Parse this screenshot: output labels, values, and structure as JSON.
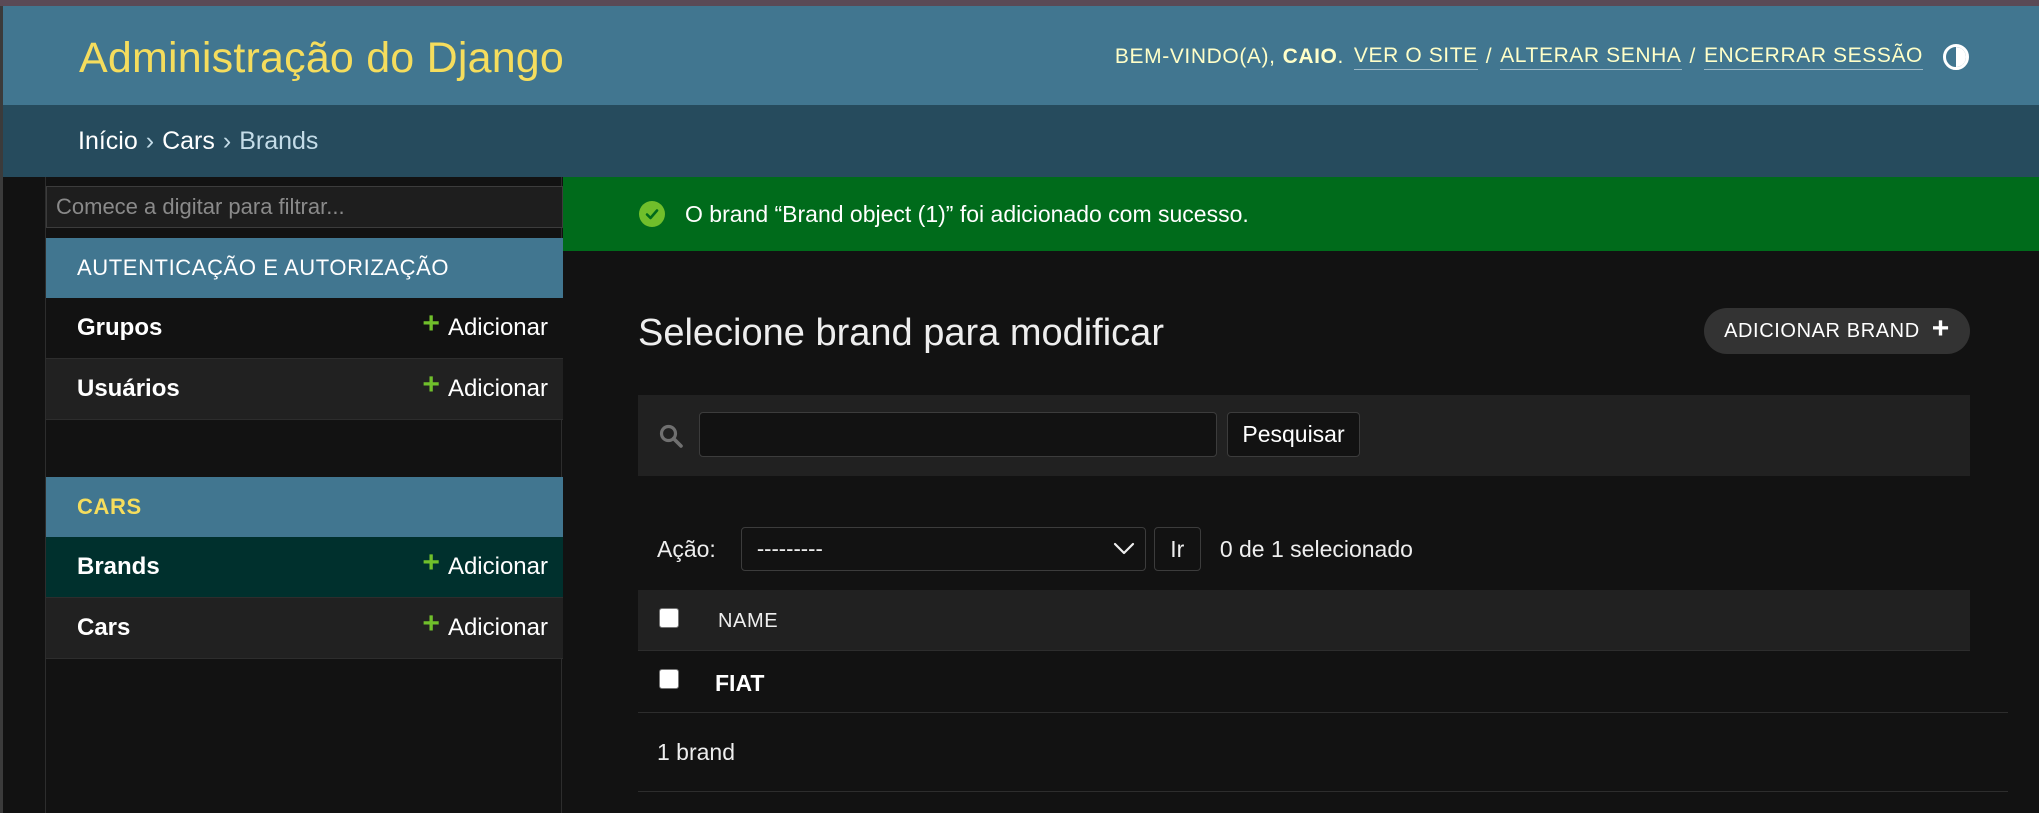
{
  "header": {
    "site_name": "Administração do Django",
    "welcome": "BEM-VINDO(A),",
    "username": "CAIO",
    "view_site": "VER O SITE",
    "change_password": "ALTERAR SENHA",
    "logout": "ENCERRAR SESSÃO",
    "separator": "/"
  },
  "breadcrumbs": {
    "home": "Início",
    "app": "Cars",
    "current": "Brands",
    "separator": "›"
  },
  "sidebar": {
    "filter_placeholder": "Comece a digitar para filtrar...",
    "modules": [
      {
        "caption": "AUTENTICAÇÃO E AUTORIZAÇÃO",
        "models": [
          {
            "name": "Grupos",
            "add_label": "Adicionar"
          },
          {
            "name": "Usuários",
            "add_label": "Adicionar"
          }
        ]
      },
      {
        "caption": "CARS",
        "models": [
          {
            "name": "Brands",
            "add_label": "Adicionar"
          },
          {
            "name": "Cars",
            "add_label": "Adicionar"
          }
        ]
      }
    ]
  },
  "messages": {
    "success": "O brand “Brand object (1)” foi adicionado com sucesso."
  },
  "content": {
    "title": "Selecione brand para modificar",
    "add_button": "ADICIONAR BRAND",
    "search_button": "Pesquisar",
    "search_value": "",
    "action_label": "Ação:",
    "action_selected": "---------",
    "go_button": "Ir",
    "selection_counter": "0 de 1 selecionado",
    "table": {
      "columns": [
        "NAME"
      ],
      "rows": [
        {
          "name": "FIAT"
        }
      ]
    },
    "paginator": "1 brand"
  },
  "colors": {
    "header_bg": "#417690",
    "branding": "#f5dd5d",
    "breadcrumbs_bg": "#264b5d",
    "success_bg": "#006b1b",
    "add_icon": "#70bf2b",
    "selected_model_bg": "#00302d"
  },
  "icons": {
    "theme_toggle": "half-circle-icon",
    "success": "check-circle-icon",
    "search": "magnifier-icon",
    "add": "plus-icon",
    "select_arrow": "chevron-down-icon"
  }
}
